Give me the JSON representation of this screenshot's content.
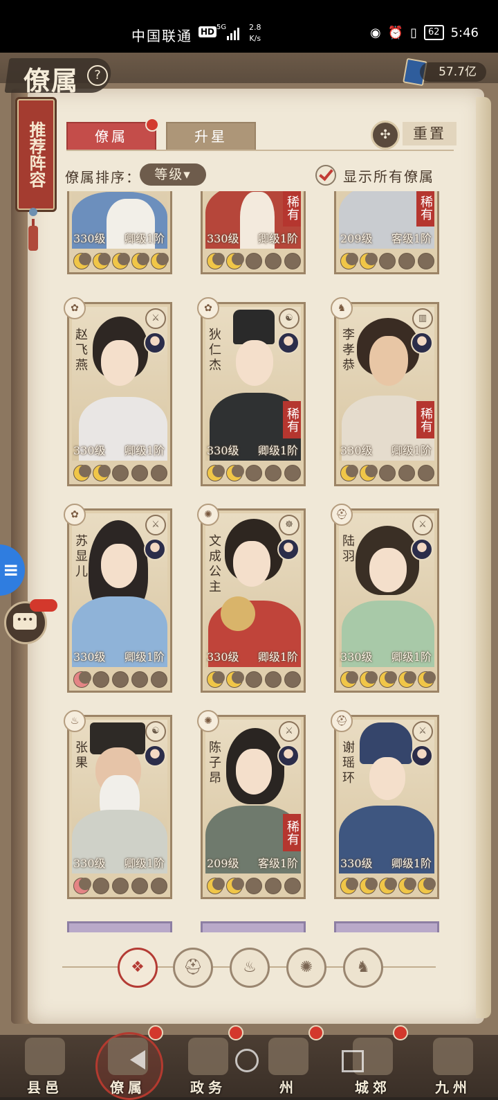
{
  "status_bar": {
    "carrier": "中国联通",
    "hd": "HD",
    "signal_type": "5G",
    "speed_value": "2.8",
    "speed_unit": "K/s",
    "battery": "62",
    "time": "5:46"
  },
  "header": {
    "title": "僚属",
    "help": "?",
    "currency": "57.7亿"
  },
  "recommend": {
    "label": "推荐阵容"
  },
  "tabs": [
    {
      "label": "僚属",
      "active": true
    },
    {
      "label": "升星",
      "active": false
    }
  ],
  "reset_label": "重置",
  "sort": {
    "label": "僚属排序：",
    "value": "等级▾"
  },
  "show_all": {
    "label": "显示所有僚属",
    "checked": true
  },
  "cards_top_row": [
    {
      "level": "330级",
      "rank": "卿级1阶",
      "rare": "",
      "moons": [
        "on",
        "on",
        "on",
        "on",
        "on"
      ]
    },
    {
      "level": "330级",
      "rank": "卿级1阶",
      "rare": "稀有",
      "moons": [
        "on",
        "on",
        "off",
        "off",
        "off"
      ]
    },
    {
      "level": "209级",
      "rank": "客级1阶",
      "rare": "稀有",
      "moons": [
        "on",
        "on",
        "off",
        "off",
        "off"
      ]
    }
  ],
  "cards": [
    {
      "name": "赵飞燕",
      "level": "330级",
      "rank": "卿级1阶",
      "rare": "",
      "moons": [
        "on",
        "on",
        "off",
        "off",
        "off"
      ]
    },
    {
      "name": "狄仁杰",
      "level": "330级",
      "rank": "卿级1阶",
      "rare": "稀有",
      "moons": [
        "on",
        "on",
        "off",
        "off",
        "off"
      ]
    },
    {
      "name": "李孝恭",
      "level": "330级",
      "rank": "卿级1阶",
      "rare": "稀有",
      "moons": [
        "on",
        "on",
        "off",
        "off",
        "off"
      ]
    },
    {
      "name": "苏显儿",
      "level": "330级",
      "rank": "卿级1阶",
      "rare": "",
      "moons": [
        "pink",
        "off",
        "off",
        "off",
        "off"
      ]
    },
    {
      "name": "文成公主",
      "level": "330级",
      "rank": "卿级1阶",
      "rare": "",
      "moons": [
        "on",
        "on",
        "off",
        "off",
        "off"
      ]
    },
    {
      "name": "陆羽",
      "level": "330级",
      "rank": "卿级1阶",
      "rare": "",
      "moons": [
        "on",
        "on",
        "on",
        "on",
        "on"
      ]
    },
    {
      "name": "张果",
      "level": "330级",
      "rank": "卿级1阶",
      "rare": "",
      "moons": [
        "pink",
        "off",
        "off",
        "off",
        "off"
      ]
    },
    {
      "name": "陈子昂",
      "level": "209级",
      "rank": "客级1阶",
      "rare": "稀有",
      "moons": [
        "on",
        "on",
        "off",
        "off",
        "off"
      ]
    },
    {
      "name": "谢瑶环",
      "level": "330级",
      "rank": "卿级1阶",
      "rare": "",
      "moons": [
        "on",
        "on",
        "on",
        "on",
        "on"
      ]
    }
  ],
  "filters": [
    {
      "icon": "diamond-filter-icon",
      "active": true
    },
    {
      "icon": "helmet-filter-icon",
      "active": false
    },
    {
      "icon": "gourd-filter-icon",
      "active": false
    },
    {
      "icon": "fan-filter-icon",
      "active": false
    },
    {
      "icon": "beast-filter-icon",
      "active": false
    }
  ],
  "bottom_nav": [
    {
      "label": "县邑",
      "dot": false
    },
    {
      "label": "僚属",
      "dot": true
    },
    {
      "label": "政务",
      "dot": true
    },
    {
      "label": "州",
      "dot": true
    },
    {
      "label": "城郊",
      "dot": true
    },
    {
      "label": "九州",
      "dot": false
    }
  ],
  "colors": {
    "accent_red": "#c44d4a",
    "parchment": "#f0e8d7",
    "moon_gold": "#f0c648"
  }
}
